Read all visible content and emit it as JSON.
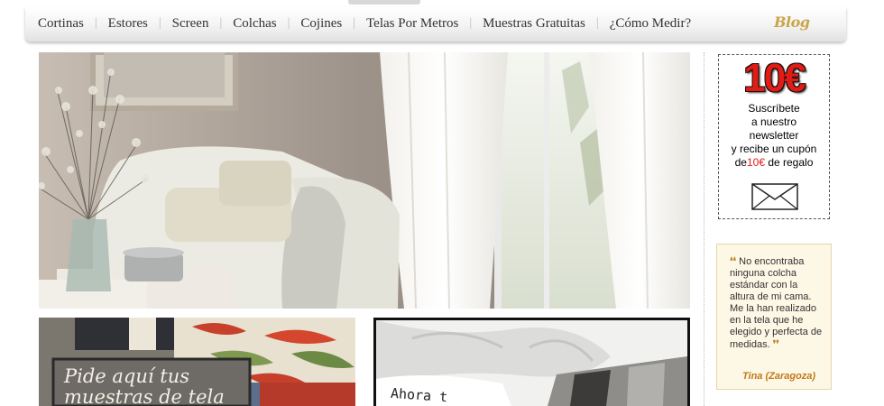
{
  "nav": {
    "items": [
      {
        "label": "Cortinas"
      },
      {
        "label": "Estores"
      },
      {
        "label": "Screen"
      },
      {
        "label": "Colchas"
      },
      {
        "label": "Cojines"
      },
      {
        "label": "Telas Por Metros"
      },
      {
        "label": "Muestras Gratuitas"
      },
      {
        "label": "¿Cómo Medir?"
      }
    ],
    "separator": "|",
    "blog_label": "Blog"
  },
  "hero": {
    "icon": "living-room-curtains-photo"
  },
  "promo_left": {
    "text_line1": "Pide aquí tus",
    "text_line2": "muestras de tela"
  },
  "promo_right": {
    "text": "Ahora t"
  },
  "newsletter": {
    "amount": "10€",
    "line1": "Suscríbete",
    "line2": "a nuestro",
    "line3": "newsletter",
    "line4": "y recibe un cupón",
    "line5_pre": "de",
    "line5_red": "10€",
    "line5_post": " de regalo",
    "icon": "envelope-icon"
  },
  "testimonial": {
    "open_quote": "❛❛",
    "text": "No encontraba ninguna colcha estándar con la altura de mi cama. Me la han realizado en la tela que he elegido y perfecta de medidas.",
    "close_quote": "❜❜",
    "author": "Tina (Zaragoza)"
  },
  "colors": {
    "accent_red": "#e21b14",
    "gold": "#c9a548",
    "testimonial_bg": "#fdf7e6"
  }
}
